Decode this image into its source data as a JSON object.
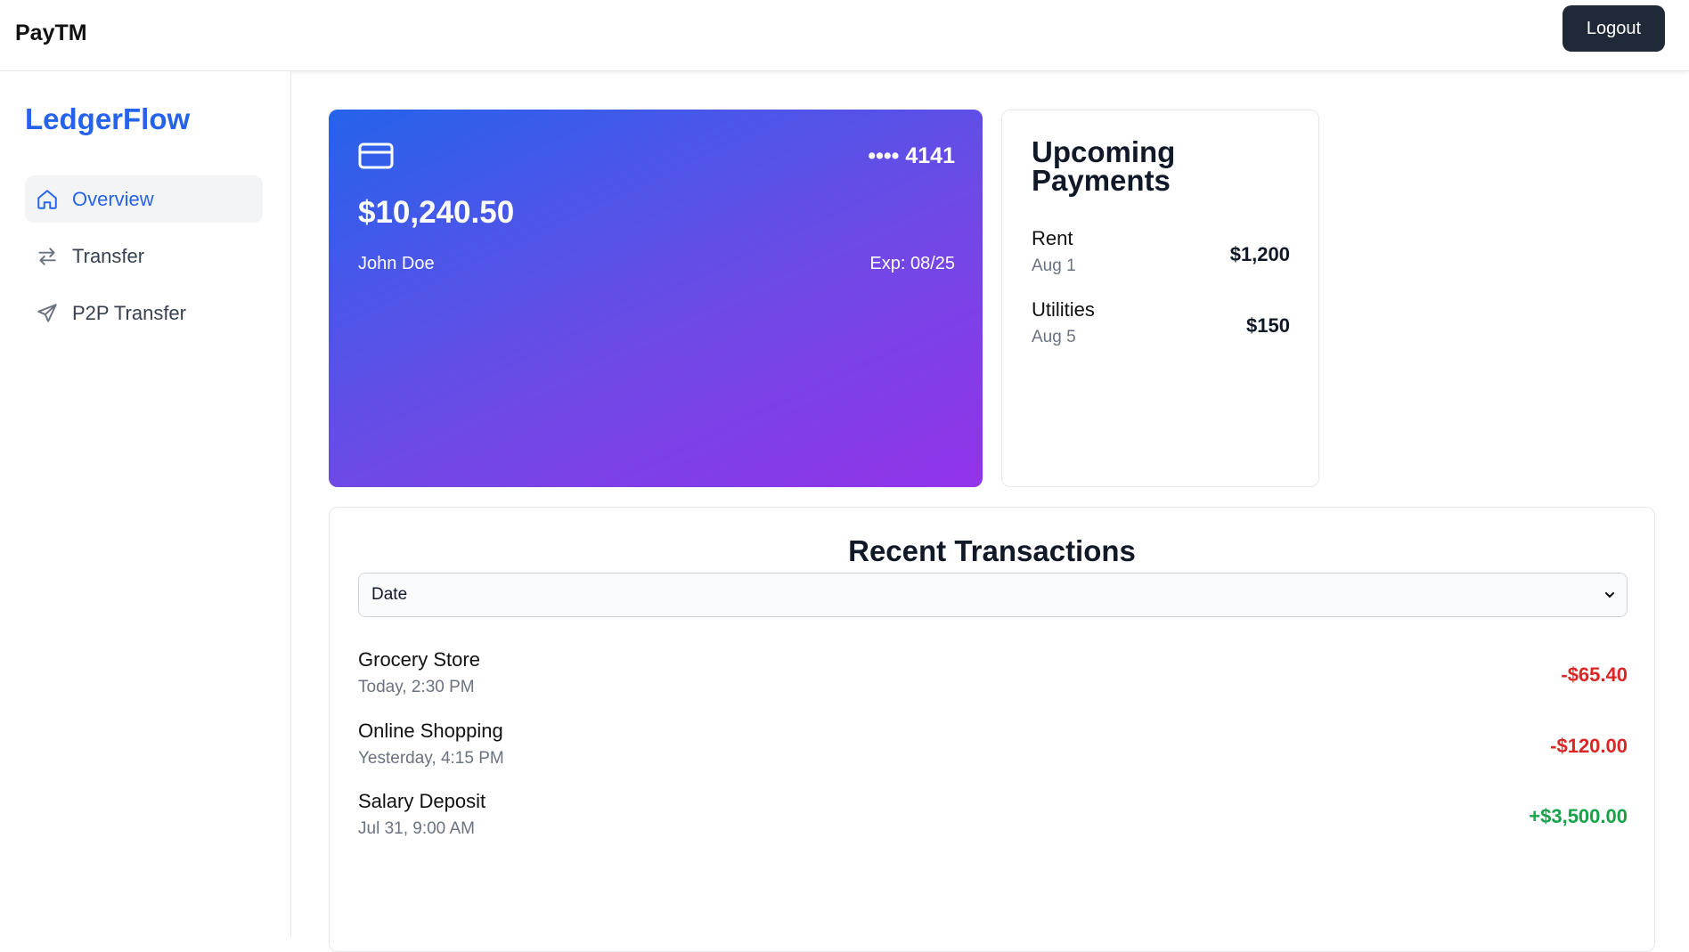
{
  "header": {
    "app_title": "PayTM",
    "logout_label": "Logout"
  },
  "sidebar": {
    "brand": "LedgerFlow",
    "items": [
      {
        "label": "Overview",
        "icon": "home-icon",
        "active": true
      },
      {
        "label": "Transfer",
        "icon": "arrows-icon",
        "active": false
      },
      {
        "label": "P2P Transfer",
        "icon": "send-icon",
        "active": false
      }
    ]
  },
  "card": {
    "icon": "credit-card-icon",
    "number": "•••• 4141",
    "balance": "$10,240.50",
    "holder": "John Doe",
    "expiry": "Exp: 08/25",
    "gradient": [
      "#2563eb",
      "#9333ea"
    ]
  },
  "upcoming": {
    "title": "Upcoming Payments",
    "items": [
      {
        "name": "Rent",
        "date": "Aug 1",
        "amount": "$1,200"
      },
      {
        "name": "Utilities",
        "date": "Aug 5",
        "amount": "$150"
      }
    ]
  },
  "transactions": {
    "title": "Recent Transactions",
    "sort_value": "Date",
    "items": [
      {
        "name": "Grocery Store",
        "time": "Today, 2:30 PM",
        "amount": "-$65.40"
      },
      {
        "name": "Online Shopping",
        "time": "Yesterday, 4:15 PM",
        "amount": "-$120.00"
      },
      {
        "name": "Salary Deposit",
        "time": "Jul 31, 9:00 AM",
        "amount": "+$3,500.00"
      }
    ]
  },
  "colors": {
    "accent": "#2563eb",
    "negative": "#dc2626",
    "positive": "#16a34a",
    "dark_button": "#1f2937"
  }
}
